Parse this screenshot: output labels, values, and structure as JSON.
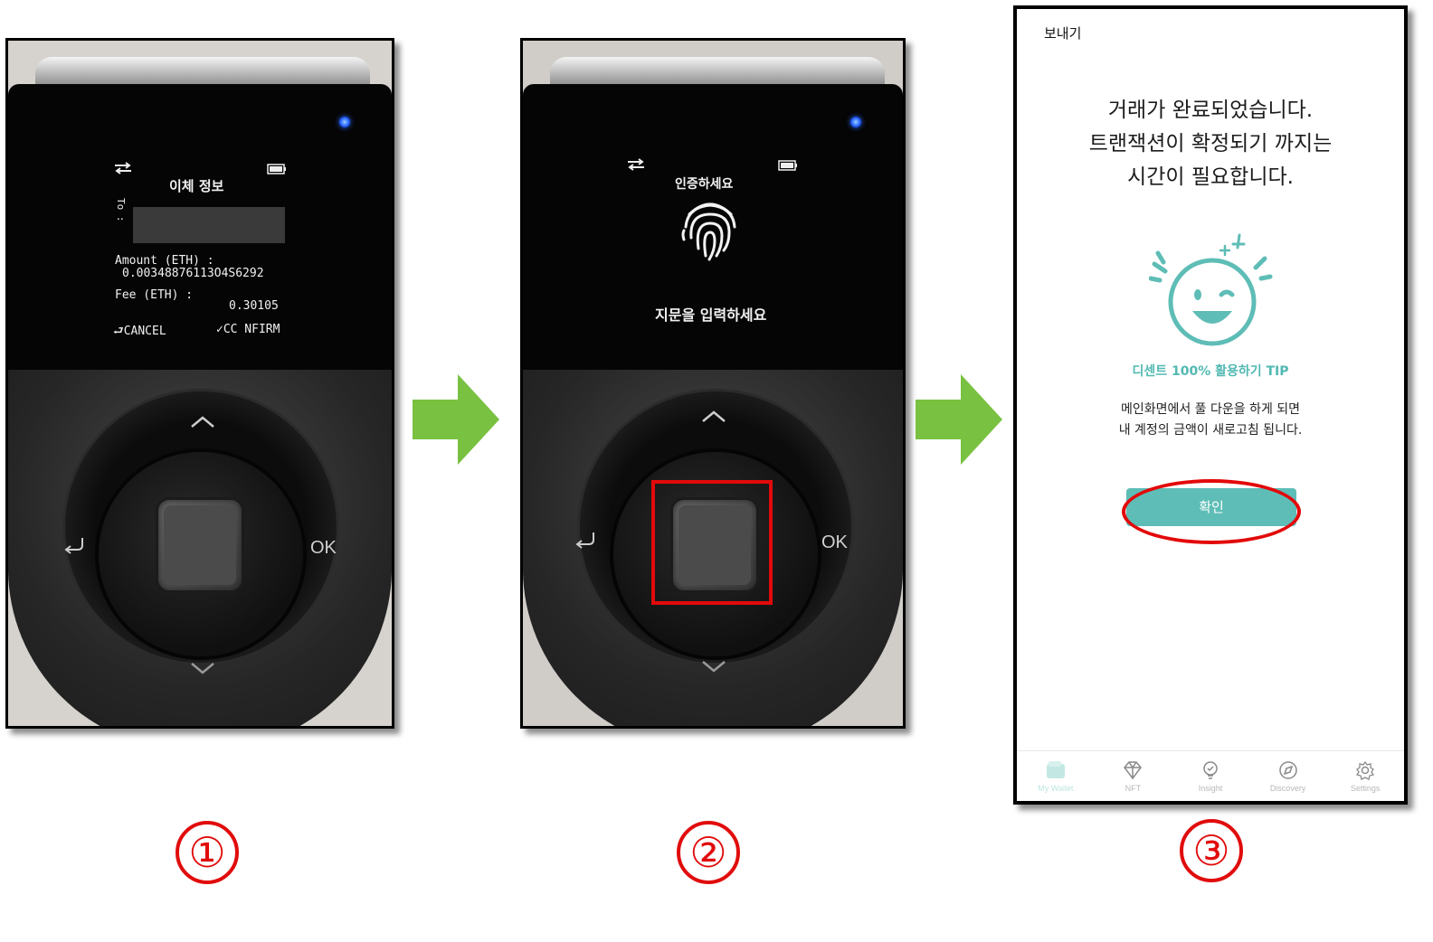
{
  "steps": [
    {
      "number": "①",
      "device": {
        "title": "이체 정보",
        "to_label": "To :",
        "amount_label": "Amount (ETH) :",
        "amount_value": "0.00348876113O4S6292",
        "fee_label": "Fee (ETH) :",
        "fee_value": "0.30105",
        "cancel": "⮐CANCEL",
        "confirm": "✓CC NFIRM",
        "ok_label": "OK"
      }
    },
    {
      "number": "②",
      "device": {
        "title": "인증하세요",
        "prompt": "지문을 입력하세요",
        "ok_label": "OK"
      }
    },
    {
      "number": "③",
      "phone": {
        "header_title": "보내기",
        "message_lines": [
          "거래가 완료되었습니다.",
          "트랜잭션이 확정되기 까지는",
          "시간이 필요합니다."
        ],
        "tip_title": "디센트 100% 활용하기 TIP",
        "tip_lines": [
          "메인화면에서 풀 다운을 하게 되면",
          "내 계정의 금액이 새로고침 됩니다."
        ],
        "confirm_button": "확인",
        "nav": [
          {
            "label": "My Wallet",
            "icon": "wallet-icon",
            "active": true
          },
          {
            "label": "NFT",
            "icon": "diamond-icon",
            "active": false
          },
          {
            "label": "Insight",
            "icon": "lightbulb-icon",
            "active": false
          },
          {
            "label": "Discovery",
            "icon": "compass-icon",
            "active": false
          },
          {
            "label": "Settings",
            "icon": "gear-icon",
            "active": false
          }
        ]
      }
    }
  ],
  "colors": {
    "arrow": "#79c141",
    "highlight": "#e10c0c",
    "accent": "#5ebdb6"
  }
}
